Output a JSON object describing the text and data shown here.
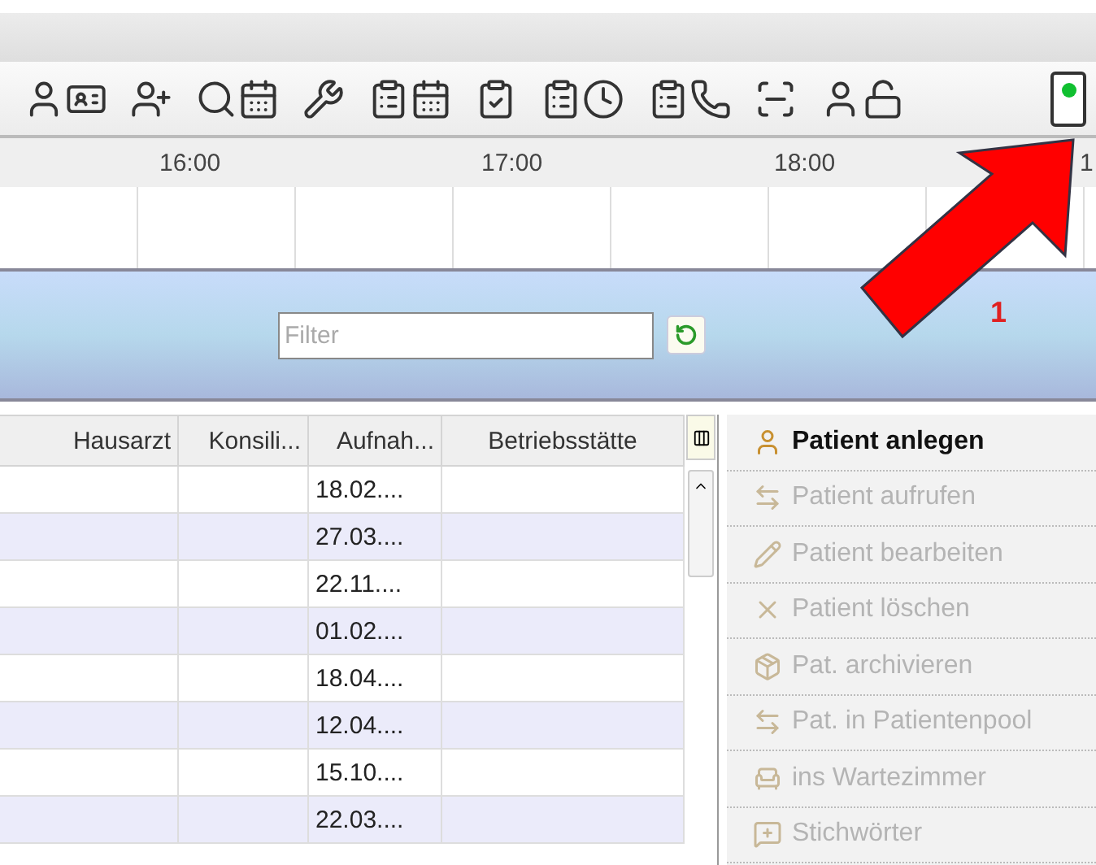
{
  "toolbar": {
    "buttons": [
      {
        "kind": "person-card"
      },
      {
        "kind": "person-add"
      },
      {
        "kind": "search-calendar"
      },
      {
        "kind": "tools"
      },
      {
        "kind": "list-calendar"
      },
      {
        "kind": "list-check"
      },
      {
        "kind": "list-clock"
      },
      {
        "kind": "list-phone"
      },
      {
        "kind": "scanner"
      },
      {
        "kind": "person-unlock"
      }
    ],
    "status_light": {
      "on": true
    }
  },
  "timeline": {
    "hours": [
      "16:00",
      "17:00",
      "18:00",
      "1"
    ]
  },
  "filter": {
    "placeholder": "Filter"
  },
  "table": {
    "columns": [
      "Hausarzt",
      "Konsili...",
      "Aufnah...",
      "Betriebsstätte"
    ],
    "rows": [
      [
        "",
        "",
        "18.02....",
        ""
      ],
      [
        "",
        "",
        "27.03....",
        ""
      ],
      [
        "",
        "",
        "22.11....",
        ""
      ],
      [
        "",
        "",
        "01.02....",
        ""
      ],
      [
        "",
        "",
        "18.04....",
        ""
      ],
      [
        "",
        "",
        "12.04....",
        ""
      ],
      [
        "",
        "",
        "15.10....",
        ""
      ],
      [
        "",
        "",
        "22.03....",
        ""
      ]
    ]
  },
  "actions": [
    {
      "label": "Patient anlegen",
      "disabled": false
    },
    {
      "label": "Patient aufrufen",
      "disabled": true
    },
    {
      "label": "Patient bearbeiten",
      "disabled": true
    },
    {
      "label": "Patient löschen",
      "disabled": true
    },
    {
      "label": "Pat. archivieren",
      "disabled": true
    },
    {
      "label": "Pat. in Patientenpool",
      "disabled": true
    },
    {
      "label": "ins Wartezimmer",
      "disabled": true
    },
    {
      "label": "Stichwörter",
      "disabled": true
    }
  ],
  "annotation": {
    "label": "1"
  }
}
